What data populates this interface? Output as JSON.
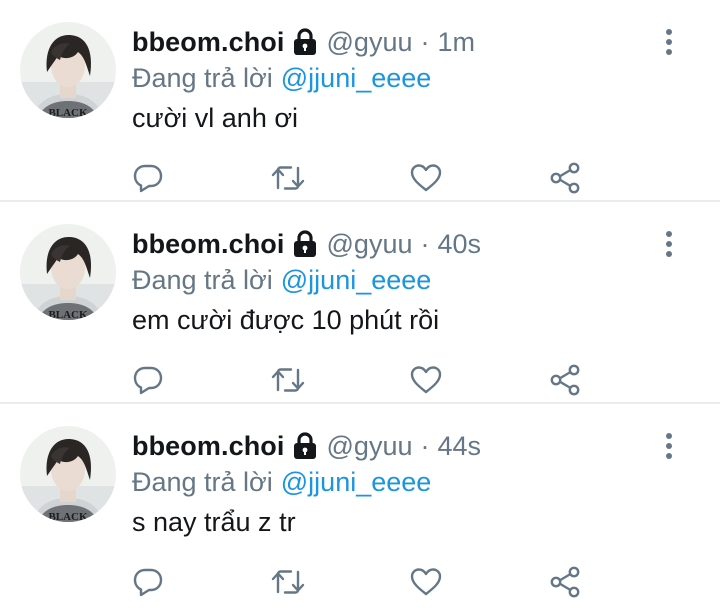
{
  "tweets": [
    {
      "display_name": "bbeom.choi",
      "handle": "@gyuu",
      "separator": "·",
      "time": "1m",
      "reply_prefix": "Đang trả lời",
      "reply_to": "@jjuni_eeee",
      "text": "cười vl anh ơi",
      "avatar_shirt_text": "BLACK"
    },
    {
      "display_name": "bbeom.choi",
      "handle": "@gyuu",
      "separator": "·",
      "time": "40s",
      "reply_prefix": "Đang trả lời",
      "reply_to": "@jjuni_eeee",
      "text": "em cười được 10 phút rồi",
      "avatar_shirt_text": "BLACK"
    },
    {
      "display_name": "bbeom.choi",
      "handle": "@gyuu",
      "separator": "·",
      "time": "44s",
      "reply_prefix": "Đang trả lời",
      "reply_to": "@jjuni_eeee",
      "text": "s nay trẩu z tr",
      "avatar_shirt_text": "BLACK"
    }
  ],
  "icons": {
    "lock": "lock-icon",
    "more": "more-vertical-icon",
    "reply": "reply-icon",
    "retweet": "retweet-icon",
    "like": "heart-icon",
    "share": "share-icon"
  },
  "colors": {
    "text_primary": "#14171a",
    "text_secondary": "#657786",
    "mention": "#1b95e0",
    "icon": "#657786",
    "divider": "#e8ecef"
  }
}
